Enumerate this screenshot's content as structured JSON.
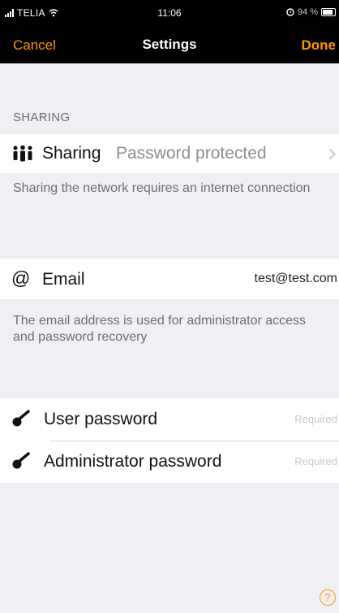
{
  "status": {
    "carrier": "TELIA",
    "time": "11:06",
    "battery": "94 %"
  },
  "nav": {
    "cancel": "Cancel",
    "title": "Settings",
    "done": "Done"
  },
  "sharing": {
    "header": "SHARING",
    "label": "Sharing",
    "value": "Password protected",
    "footer": "Sharing the network requires an internet connection"
  },
  "email": {
    "label": "Email",
    "value": "test@test.com",
    "footer": "The email address is used for administrator access and password recovery"
  },
  "passwords": [
    {
      "label": "User password",
      "value": "Required"
    },
    {
      "label": "Administrator password",
      "value": "Required"
    }
  ],
  "help": "?",
  "colors": {
    "accent": "#ff9500",
    "navbar": "#000000",
    "background": "#efeff4"
  }
}
